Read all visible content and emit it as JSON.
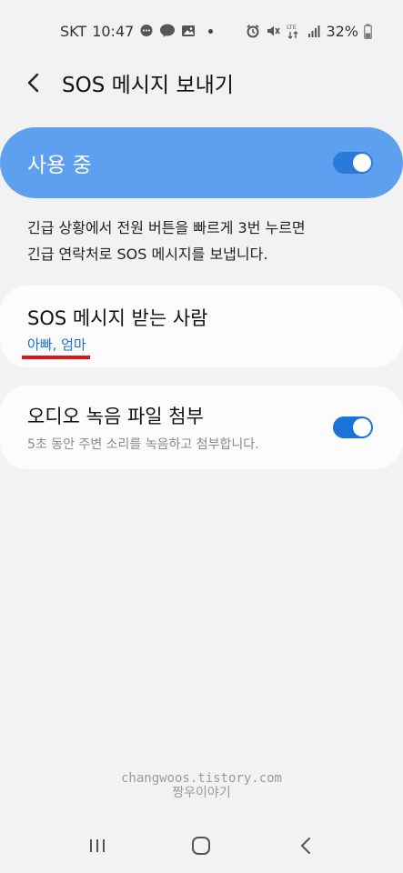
{
  "status_bar": {
    "carrier": "SKT",
    "time": "10:47",
    "battery": "32%",
    "lte_label": "LTE",
    "notification_icons": [
      "chat-bubble-icon",
      "talk-icon",
      "image-icon"
    ],
    "right_icons": [
      "alarm-icon",
      "mute-icon",
      "lte-signal-icon",
      "signal-bars-icon",
      "battery-icon"
    ]
  },
  "header": {
    "title": "SOS 메시지 보내기"
  },
  "master_switch": {
    "label": "사용 중",
    "on": true
  },
  "description": {
    "line1": "긴급 상황에서 전원 버튼을 빠르게 3번 누르면",
    "line2": "긴급 연락처로 SOS 메시지를 보냅니다."
  },
  "recipients": {
    "title": "SOS 메시지 받는 사람",
    "value": "아빠, 엄마"
  },
  "audio": {
    "title": "오디오 녹음 파일 첨부",
    "subtitle": "5초 동안 주변 소리를 녹음하고 첨부합니다.",
    "on": true
  },
  "watermark": {
    "line1": "changwoos.tistory.com",
    "line2": "짱우이야기"
  },
  "nav": {
    "buttons": [
      "recent-apps-icon",
      "home-icon",
      "back-icon"
    ]
  },
  "colors": {
    "accent": "#5da0ef",
    "toggle_on": "#1a73d9",
    "link_blue": "#1a6fd0",
    "underline_red": "#e01414",
    "background": "#f2f2f2"
  }
}
